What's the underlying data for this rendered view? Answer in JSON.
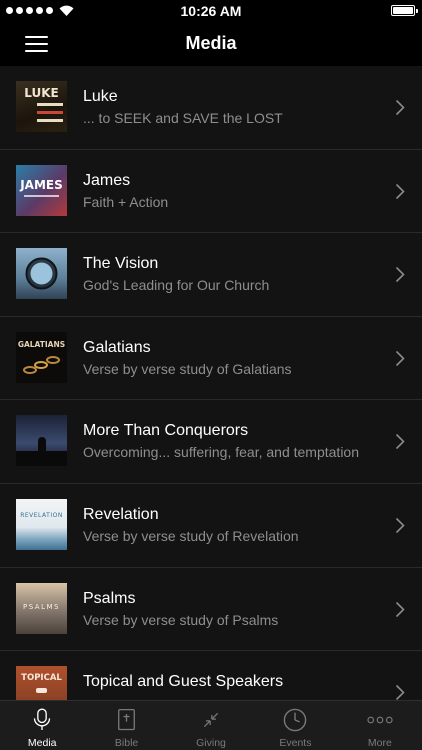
{
  "status_bar": {
    "time": "10:26 AM"
  },
  "nav": {
    "title": "Media"
  },
  "media_items": [
    {
      "title": "Luke",
      "subtitle": "... to SEEK and SAVE the LOST",
      "thumb_text": "LUKE"
    },
    {
      "title": "James",
      "subtitle": "Faith + Action",
      "thumb_text": "JAMES"
    },
    {
      "title": "The Vision",
      "subtitle": "God's Leading for Our Church",
      "thumb_text": ""
    },
    {
      "title": "Galatians",
      "subtitle": "Verse by verse study of Galatians",
      "thumb_text": "GALATIANS"
    },
    {
      "title": "More Than Conquerors",
      "subtitle": "Overcoming... suffering, fear, and temptation",
      "thumb_text": ""
    },
    {
      "title": "Revelation",
      "subtitle": "Verse by verse study of Revelation",
      "thumb_text": "REVELATION"
    },
    {
      "title": "Psalms",
      "subtitle": "Verse by verse study of Psalms",
      "thumb_text": "PSALMS"
    },
    {
      "title": "Topical and Guest Speakers",
      "subtitle": "",
      "thumb_text": "TOPICAL"
    }
  ],
  "tabs": [
    {
      "label": "Media",
      "icon": "microphone-icon",
      "active": true
    },
    {
      "label": "Bible",
      "icon": "bible-icon",
      "active": false
    },
    {
      "label": "Giving",
      "icon": "giving-icon",
      "active": false
    },
    {
      "label": "Events",
      "icon": "clock-icon",
      "active": false
    },
    {
      "label": "More",
      "icon": "more-icon",
      "active": false
    }
  ]
}
